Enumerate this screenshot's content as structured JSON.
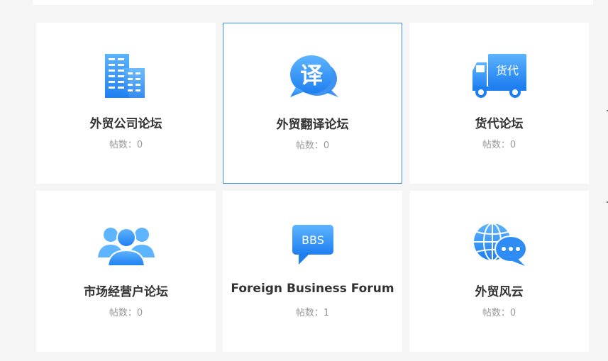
{
  "forums": [
    {
      "title": "外贸公司论坛",
      "posts_label": "帖数：",
      "posts": "0",
      "icon": "building-icon"
    },
    {
      "title": "外贸翻译论坛",
      "posts_label": "帖数：",
      "posts": "0",
      "icon": "translate-bubble-icon",
      "icon_text": "译"
    },
    {
      "title": "货代论坛",
      "posts_label": "帖数：",
      "posts": "0",
      "icon": "delivery-truck-icon",
      "icon_text": "货代"
    },
    {
      "title": "市场经营户论坛",
      "posts_label": "帖数：",
      "posts": "0",
      "icon": "user-group-icon"
    },
    {
      "title": "Foreign Business Forum",
      "posts_label": "帖数：",
      "posts": "1",
      "icon": "bbs-bubble-icon",
      "icon_text": "BBS"
    },
    {
      "title": "外贸风云",
      "posts_label": "帖数：",
      "posts": "0",
      "icon": "globe-chat-icon"
    }
  ],
  "colors": {
    "accent": "#3d8ee6",
    "icon_blue": "#2f8cf5",
    "title": "#333333",
    "muted": "#999999",
    "background": "#f5f5f5",
    "card": "#ffffff"
  }
}
